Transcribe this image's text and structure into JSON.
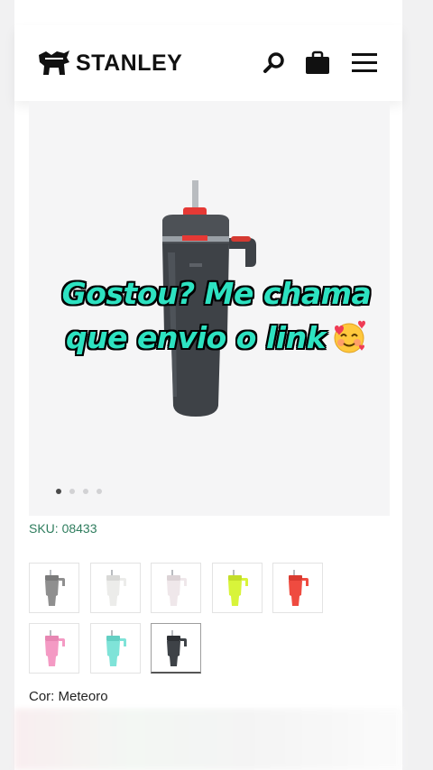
{
  "header": {
    "brand": "STANLEY",
    "icons": [
      "stanley-bear-logo-icon",
      "search-icon",
      "bag-icon",
      "hamburger-menu-icon"
    ]
  },
  "product": {
    "sku": "SKU: 08433",
    "color_label": "Cor: Meteoro",
    "gallery_dots": 4,
    "active_dot": 1
  },
  "overlay": {
    "line1": "Gostou? Me chama",
    "line2": "que envio o link",
    "emoji": "smiling-face-with-hearts-icon"
  },
  "swatches": [
    {
      "name": "gray",
      "color": "#8f8f8f",
      "lid": "#7a7a7a"
    },
    {
      "name": "white",
      "color": "#ececea",
      "lid": "#d9d9d7"
    },
    {
      "name": "light-pink-white",
      "color": "#efe7ea",
      "lid": "#dcd3d6"
    },
    {
      "name": "lime",
      "color": "#d8f43a",
      "lid": "#c3de2a"
    },
    {
      "name": "red",
      "color": "#ef4b40",
      "lid": "#d93a30"
    },
    {
      "name": "pink",
      "color": "#f49ac4",
      "lid": "#e786b2"
    },
    {
      "name": "aqua",
      "color": "#7fe3d8",
      "lid": "#63cfc3"
    },
    {
      "name": "meteoro",
      "color": "#3e4247",
      "lid": "#2d3034",
      "selected": true
    }
  ],
  "colors": {
    "sku_green": "#2f7d5e",
    "overlay_text": "#2de2c1",
    "accent_red": "#e53935"
  }
}
